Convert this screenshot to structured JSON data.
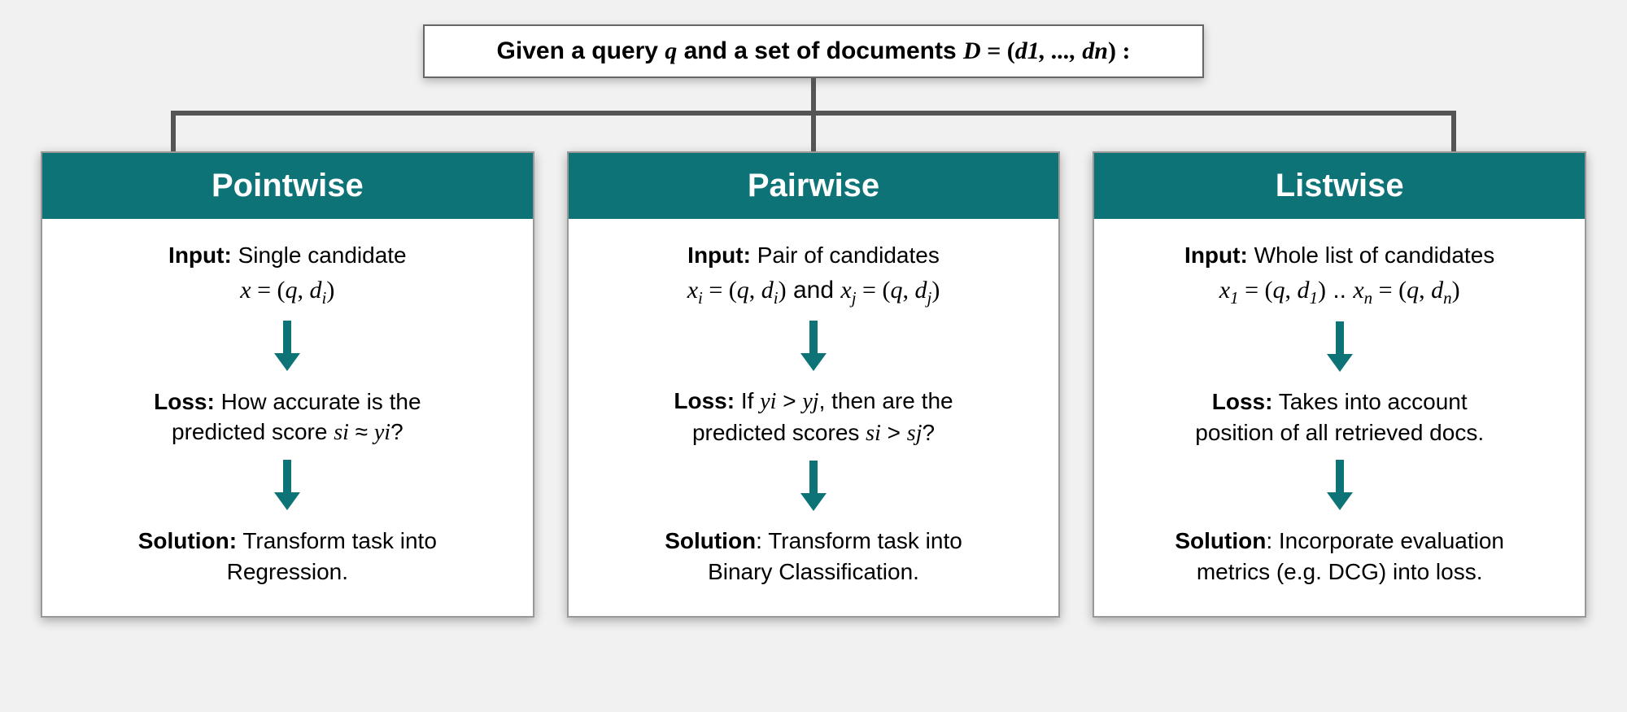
{
  "root": {
    "prefix": "Given  a query ",
    "q": "q",
    "mid": " and a set of documents ",
    "D": "D",
    "eq": " = (",
    "d1": "d",
    "d1sub": "1",
    "sep": ", ..., ",
    "dn": "d",
    "dnsub": "n",
    "suffix": ") :"
  },
  "cards": {
    "pointwise": {
      "title": "Pointwise",
      "input_label": "Input:",
      "input_text": " Single candidate",
      "formula_x": "x",
      "formula_eq": " = (",
      "formula_q": "q",
      "formula_sep": ", ",
      "formula_d": "d",
      "formula_dsub": "i",
      "formula_close": ")",
      "loss_label": "Loss:",
      "loss_text1": " How accurate is the",
      "loss_text2": "predicted score ",
      "loss_s": "s",
      "loss_ssub": "i",
      "loss_approx": " ≈ ",
      "loss_y": "y",
      "loss_ysub": "i",
      "loss_q": "?",
      "sol_label": "Solution:",
      "sol_text1": " Transform task into",
      "sol_text2": "Regression."
    },
    "pairwise": {
      "title": "Pairwise",
      "input_label": "Input:",
      "input_text": " Pair of candidates",
      "f_xi": "x",
      "f_xi_sub": "i",
      "f_eq": " = (",
      "f_q": "q",
      "f_sep": ", ",
      "f_d": "d",
      "f_di_sub": "i",
      "f_close": ")",
      "f_and": "    and    ",
      "f_xj": "x",
      "f_xj_sub": "j",
      "f_dj_sub": "j",
      "loss_label": "Loss:",
      "loss_if": " If ",
      "loss_yi": "y",
      "loss_yi_sub": "i",
      "loss_gt": " > ",
      "loss_yj": "y",
      "loss_yj_sub": "j",
      "loss_then": ", then are the",
      "loss_line2": "predicted scores ",
      "loss_si": "s",
      "loss_si_sub": "i",
      "loss_sj": "s",
      "loss_sj_sub": "j",
      "loss_q": "?",
      "sol_label": "Solution",
      "sol_colon": ": ",
      "sol_text1": "Transform task into",
      "sol_text2": "Binary Classification."
    },
    "listwise": {
      "title": "Listwise",
      "input_label": "Input:",
      "input_text": " Whole list of candidates",
      "f_x1": "x",
      "f_x1_sub": "1",
      "f_eq": " = (",
      "f_q": "q",
      "f_sep": ", ",
      "f_d": "d",
      "f_d1_sub": "1",
      "f_close": ")",
      "f_dots": "    ..    ",
      "f_xn": "x",
      "f_xn_sub": "n",
      "f_dn_sub": "n",
      "loss_label": "Loss:",
      "loss_text1": " Takes into account",
      "loss_text2": "position of all retrieved docs.",
      "sol_label": "Solution",
      "sol_colon": ": ",
      "sol_text1": "Incorporate evaluation",
      "sol_text2": "metrics (e.g. DCG) into loss."
    }
  }
}
